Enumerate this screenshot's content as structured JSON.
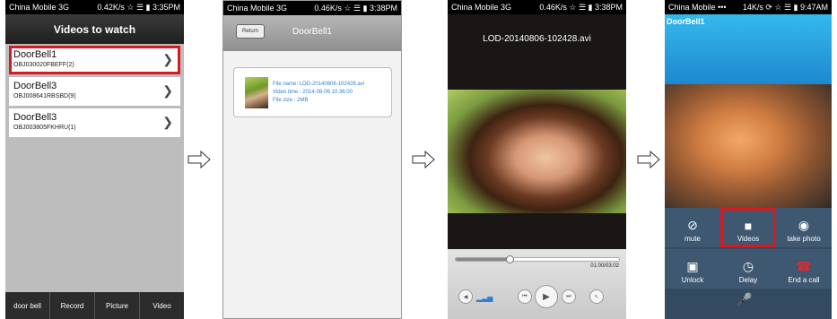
{
  "colors": {
    "highlight": "#d71920",
    "accent_blue": "#2f7fd4",
    "hangup_red": "#e02b2b"
  },
  "screen1": {
    "status": {
      "carrier": "China Mobile 3G",
      "right": "0.42K/s ☆ ☰ ▮ 3:35PM"
    },
    "title": "Videos to watch",
    "items": [
      {
        "name": "DoorBell1",
        "id": "OBJ030020FBEFF(2)"
      },
      {
        "name": "DoorBell3",
        "id": "OBJ008641RBSBD(9)"
      },
      {
        "name": "DoorBell3",
        "id": "OBJ003805FKHRU(1)"
      }
    ],
    "tabs": [
      "door bell",
      "Record",
      "Picture",
      "Video"
    ]
  },
  "screen2": {
    "status": {
      "carrier": "China Mobile 3G",
      "right": "0.46K/s ☆ ☰ ▮ 3:38PM"
    },
    "back_label": "Return",
    "title": "DoorBell1",
    "file_name_label": "File name:",
    "file_name": "LOD-20140806-102428.avi",
    "video_time_label": "Video time :",
    "video_time": "2014-08-06 10:36:00",
    "file_size_label": "File size :",
    "file_size": "2MB"
  },
  "screen3": {
    "status": {
      "carrier": "China Mobile 3G",
      "right": "0.46K/s ☆ ☰ ▮ 3:38PM"
    },
    "title": "LOD-20140806-102428.avi",
    "time": "01:00/03:02",
    "progress": 0.33
  },
  "screen4": {
    "status": {
      "carrier": "China Mobile •••",
      "right": "14K/s ⟳ ☆ ☰ ▮ 9:47AM"
    },
    "name": "DoorBell1",
    "buttons": [
      {
        "label": "mute",
        "icon": "⊘"
      },
      {
        "label": "Videos",
        "icon": "■"
      },
      {
        "label": "take photo",
        "icon": "◉"
      },
      {
        "label": "Unlock",
        "icon": "▣"
      },
      {
        "label": "Delay",
        "icon": "◷"
      },
      {
        "label": "End a call",
        "icon": "☎"
      }
    ]
  }
}
